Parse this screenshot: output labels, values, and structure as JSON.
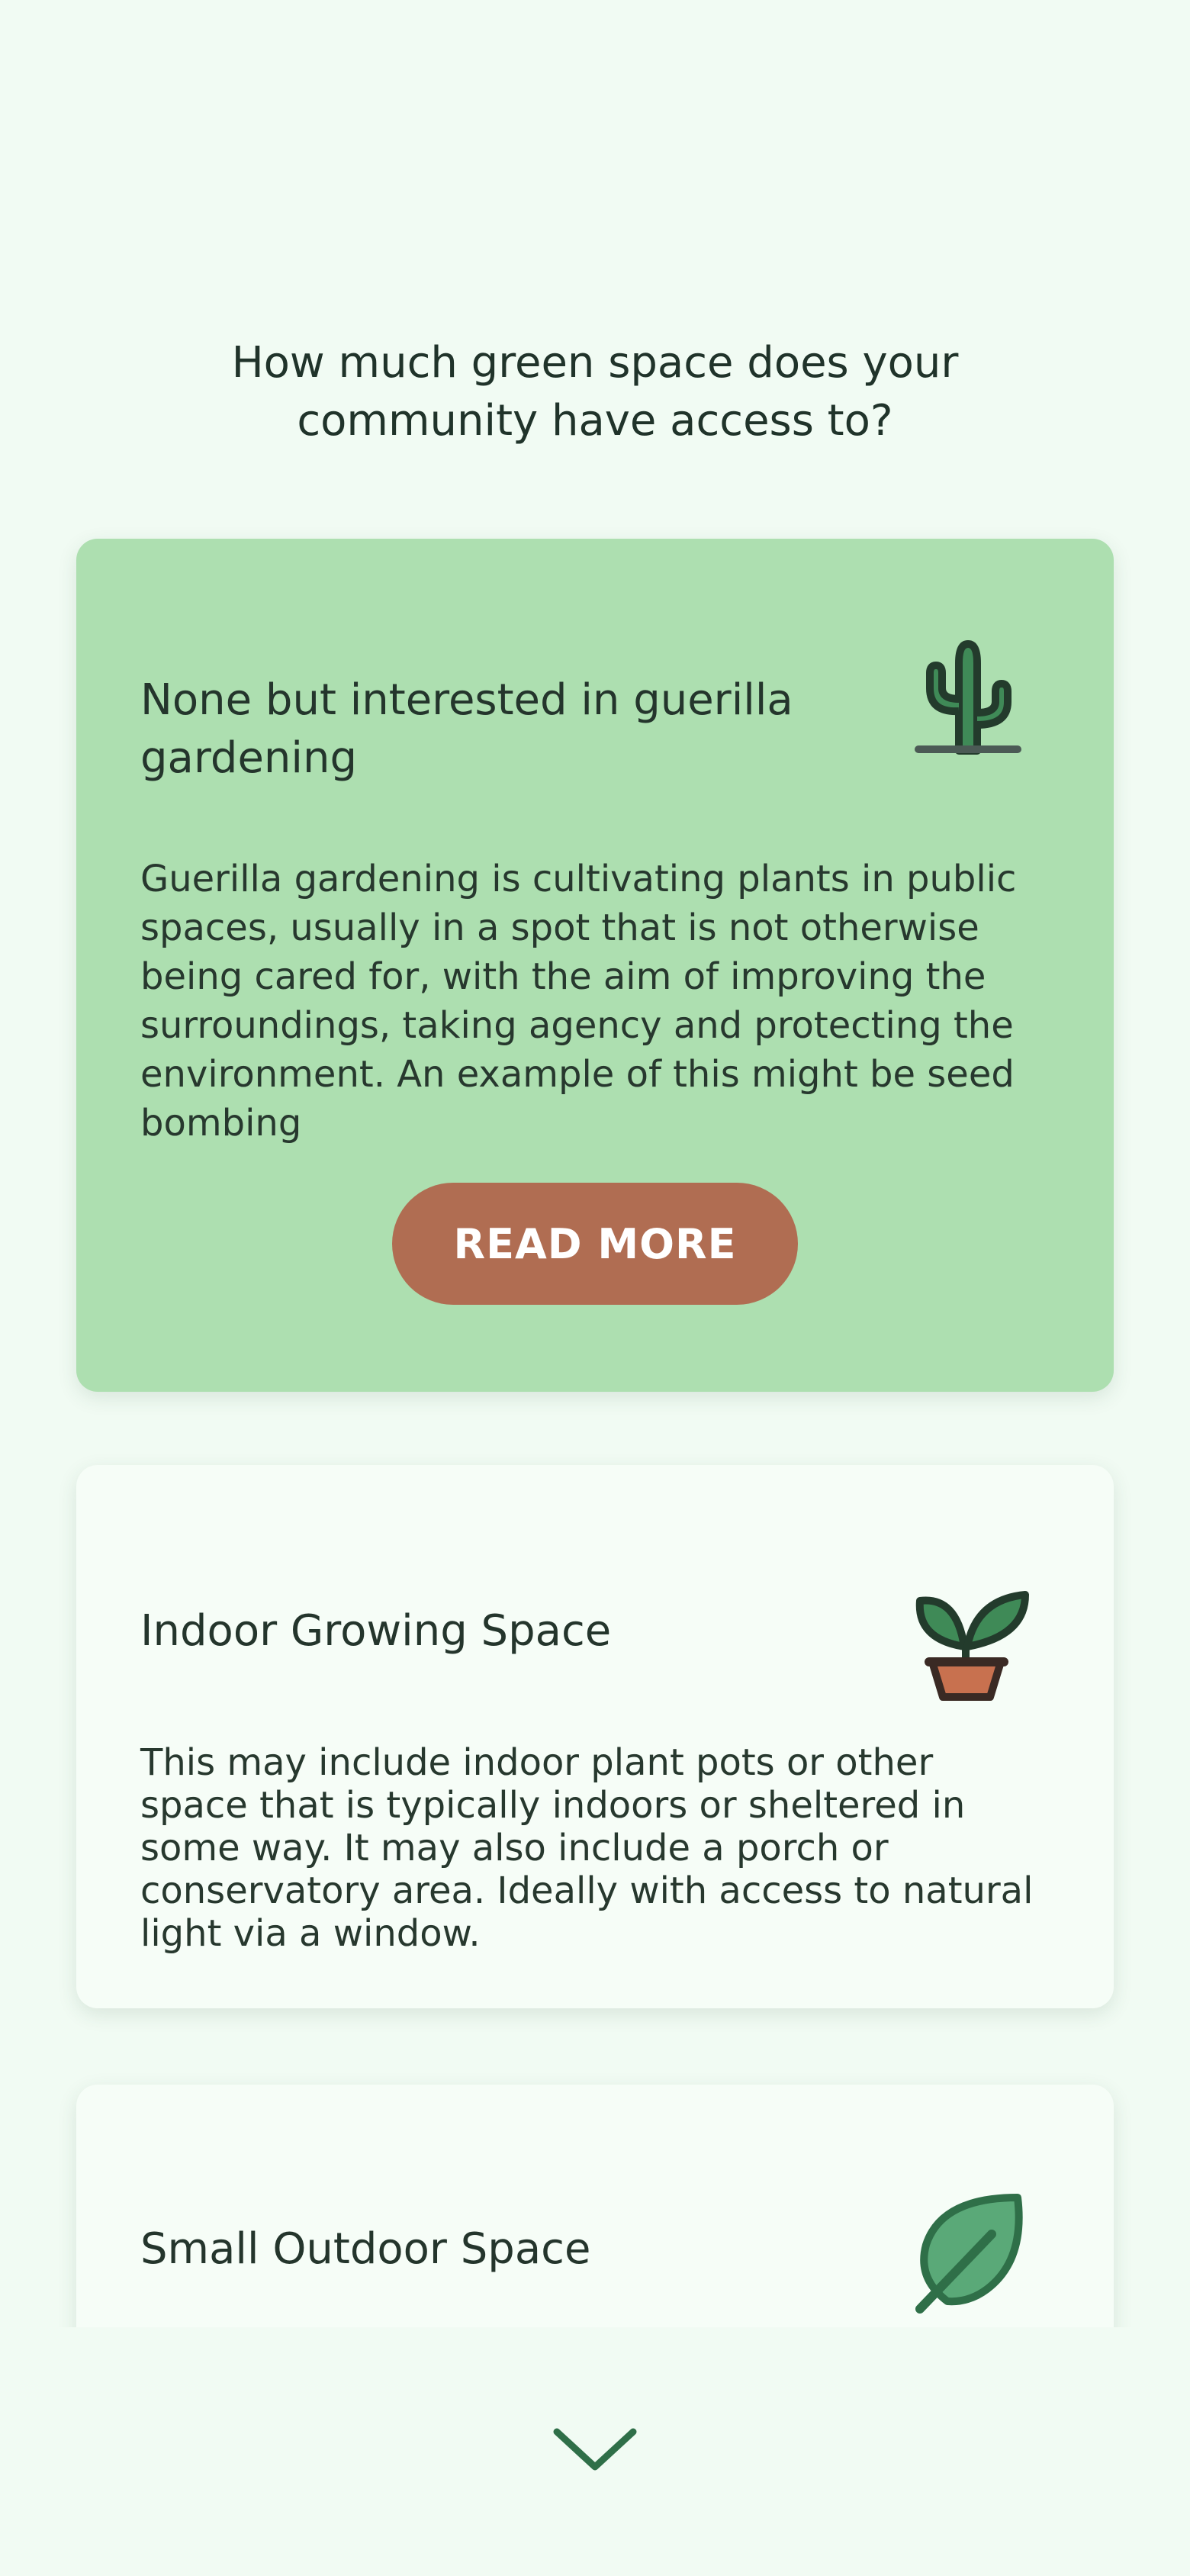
{
  "question": "How much green space does your community have access to?",
  "options": [
    {
      "title": "None but interested in guerilla gardening",
      "description": "Guerilla gardening is cultivating plants in public spaces, usually in a spot that is not otherwise being cared for, with the aim of improving the surroundings, taking agency and protecting the environment. An example of this might be seed bombing",
      "button_label": "READ MORE",
      "icon": "cactus-icon",
      "selected": true
    },
    {
      "title": "Indoor Growing Space",
      "description": "This may include indoor plant pots or other space that is typically indoors or sheltered in some way. It may also include a porch or conservatory area. Ideally with access to natural light via a window.",
      "icon": "potted-plant-icon",
      "selected": false
    },
    {
      "title": "Small Outdoor Space",
      "icon": "leaf-icon",
      "selected": false
    }
  ],
  "scroll_indicator": "chevron-down-icon",
  "colors": {
    "background": "#f1fbf3",
    "selected_card": "#addfb0",
    "card": "#f6fdf7",
    "button": "#b06d52",
    "text": "#1f2b24"
  }
}
